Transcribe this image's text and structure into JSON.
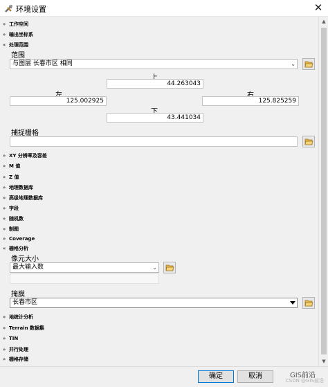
{
  "window": {
    "title": "环境设置",
    "close_glyph": "✕"
  },
  "sections": {
    "workspace": "工作空间",
    "output_coords": "输出坐标系",
    "processing_extent": "处理范围",
    "xy_resolution": "XY 分辨率及容差",
    "m_values": "M 值",
    "z_values": "Z 值",
    "geodatabase": "地理数据库",
    "geodatabase_advanced": "高级地理数据库",
    "fields": "字段",
    "random_numbers": "随机数",
    "cartography": "制图",
    "coverage": "Coverage",
    "raster_analysis": "栅格分析",
    "geostatistical": "地统计分析",
    "terrain": "Terrain 数据集",
    "tin": "TIN",
    "parallel": "并行处理",
    "raster_storage": "栅格存储"
  },
  "extent": {
    "label": "范围",
    "value": "与图层 长春市区 相同",
    "top_label": "上",
    "top_value": "44.263043",
    "left_label": "左",
    "left_value": "125.002925",
    "right_label": "右",
    "right_value": "125.825259",
    "bottom_label": "下",
    "bottom_value": "43.441034",
    "snap_label": "捕捉栅格",
    "snap_value": ""
  },
  "raster": {
    "cell_size_label": "像元大小",
    "cell_size_value": "最大输入数",
    "mask_label": "掩膜",
    "mask_value": "长春市区"
  },
  "footer": {
    "ok_label": "确定",
    "cancel_label": "取消",
    "watermark": "GIS前沿",
    "watermark_sub": "CSDN @GIS前沿"
  },
  "icons": {
    "title": "tools-icon",
    "browse": "folder-open-icon",
    "collapse": "double-chevron-up-icon",
    "expand": "double-chevron-down-icon"
  },
  "colors": {
    "panel_bg": "#f0f0f0",
    "folder": "#e8b84a",
    "default_button_border": "#0078d7"
  }
}
